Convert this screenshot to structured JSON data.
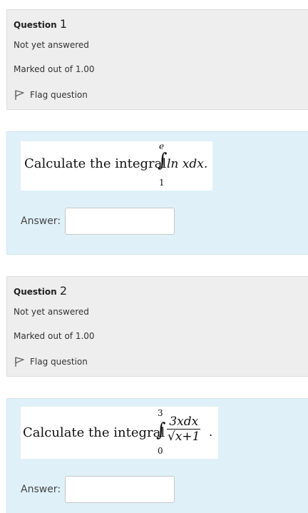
{
  "questions": [
    {
      "label": "Question",
      "number": "1",
      "status": "Not yet answered",
      "marks": "Marked out of 1.00",
      "flag_label": "Flag question",
      "prompt": "Calculate the integral",
      "integral_upper": "e",
      "integral_lower": "1",
      "integrand": "ln xdx.",
      "answer_label": "Answer:",
      "answer_value": ""
    },
    {
      "label": "Question",
      "number": "2",
      "status": "Not yet answered",
      "marks": "Marked out of 1.00",
      "flag_label": "Flag question",
      "prompt": "Calculate the integral",
      "integral_upper": "3",
      "integral_lower": "0",
      "integrand_numerator": "3xdx",
      "integrand_denominator": "x+1",
      "integrand_suffix": ".",
      "answer_label": "Answer:",
      "answer_value": ""
    }
  ]
}
